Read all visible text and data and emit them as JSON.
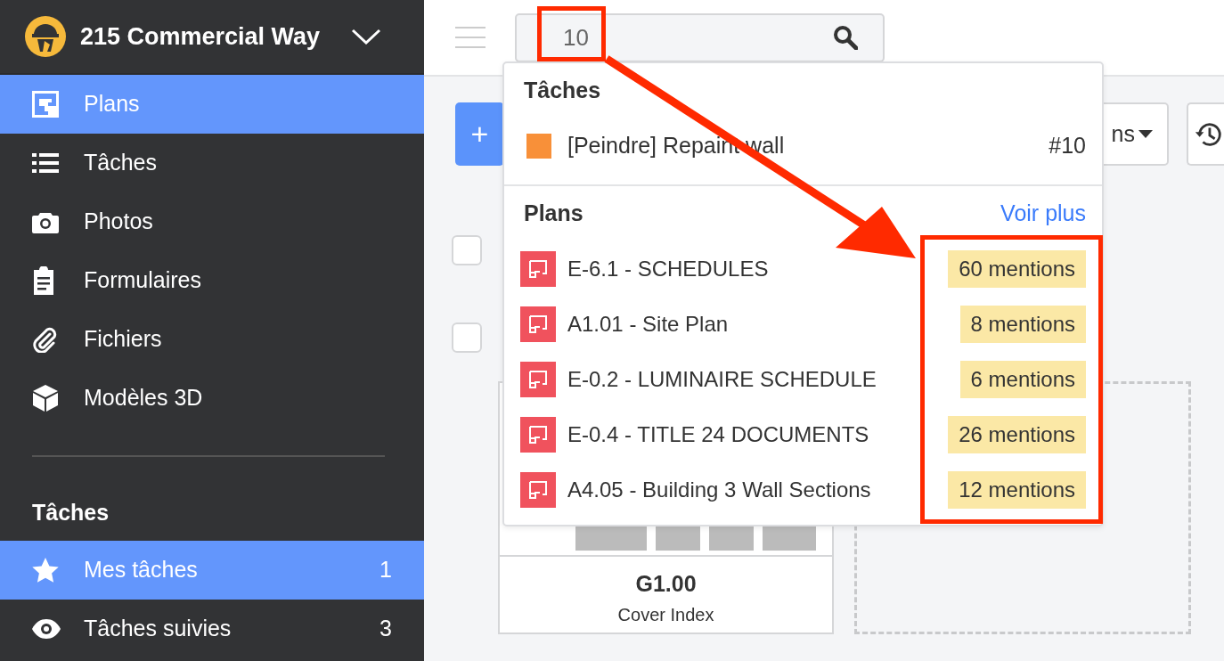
{
  "project": {
    "name": "215 Commercial Way"
  },
  "nav": [
    {
      "label": "Plans",
      "selected": true
    },
    {
      "label": "Tâches",
      "selected": false
    },
    {
      "label": "Photos",
      "selected": false
    },
    {
      "label": "Formulaires",
      "selected": false
    },
    {
      "label": "Fichiers",
      "selected": false
    },
    {
      "label": "Modèles 3D",
      "selected": false
    }
  ],
  "tasks_section": {
    "title": "Tâches",
    "items": [
      {
        "label": "Mes tâches",
        "count": "1",
        "selected": true
      },
      {
        "label": "Tâches suivies",
        "count": "3",
        "selected": false
      }
    ]
  },
  "list_rows": [
    {
      "checked": false
    },
    {
      "checked": false
    }
  ],
  "search": {
    "value": "10"
  },
  "toolbar": {
    "add_button": "+",
    "filter_button": "ns"
  },
  "plan_card": {
    "code": "G1.00",
    "title": "Cover Index"
  },
  "results": {
    "tasks": {
      "title": "Tâches",
      "items": [
        {
          "name": "[Peindre] Repaint wall",
          "number": "#10",
          "color": "#f89039"
        }
      ]
    },
    "plans": {
      "title": "Plans",
      "more": "Voir plus",
      "items": [
        {
          "name": "E-6.1 - SCHEDULES",
          "mentions": "60 mentions"
        },
        {
          "name": "A1.01 - Site Plan",
          "mentions": "8 mentions"
        },
        {
          "name": "E-0.2 - LUMINAIRE SCHEDULE",
          "mentions": "6 mentions"
        },
        {
          "name": "E-0.4 - TITLE 24 DOCUMENTS",
          "mentions": "26 mentions"
        },
        {
          "name": "A4.05 - Building 3 Wall Sections",
          "mentions": "12 mentions"
        }
      ]
    }
  }
}
